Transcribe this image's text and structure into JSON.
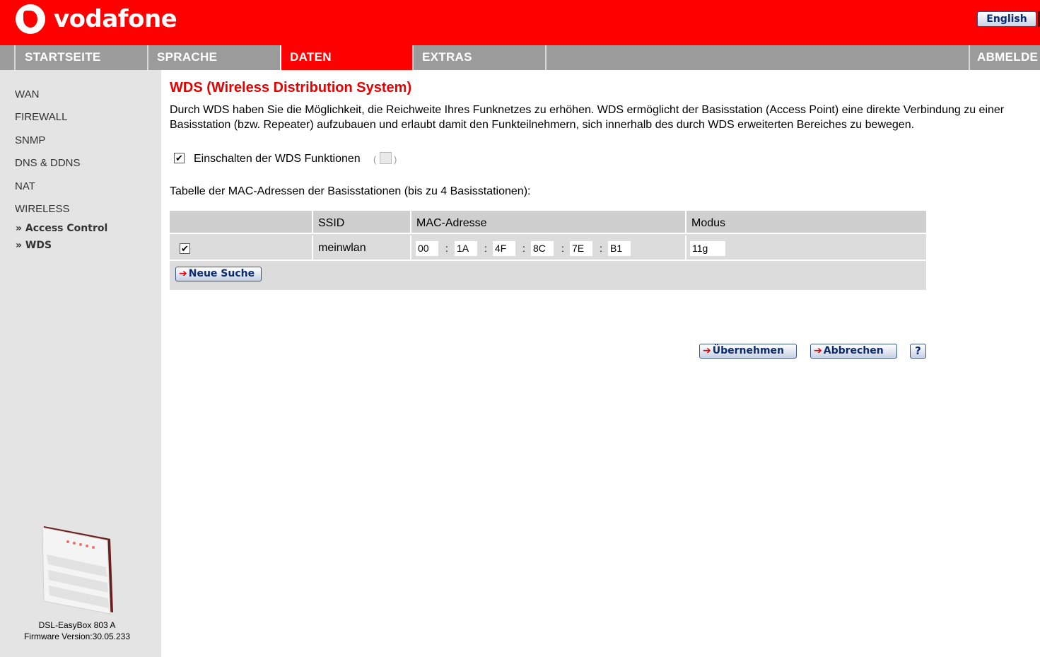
{
  "header": {
    "brand": "vodafone",
    "language_button": "English"
  },
  "nav": {
    "items": [
      {
        "label": "STARTSEITE"
      },
      {
        "label": "SPRACHE"
      },
      {
        "label": "DATEN",
        "active": true
      },
      {
        "label": "EXTRAS"
      },
      {
        "label": "ABMELDE"
      }
    ]
  },
  "sidebar": {
    "links": [
      "WAN",
      "FIREWALL",
      "SNMP",
      "DNS & DDNS",
      "NAT",
      "WIRELESS"
    ],
    "sub_links": [
      "» Access Control",
      "» WDS"
    ],
    "device_name": "DSL-EasyBox 803 A",
    "firmware": "Firmware Version:30.05.233"
  },
  "main": {
    "title": "WDS (Wireless Distribution System)",
    "description_line1": "Durch WDS haben Sie die Möglichkeit, die Reichweite Ihres Funknetzes zu erhöhen. WDS ermöglicht der Basisstation (Access Point) eine direkte Verbindung zu einer",
    "description_line2": "Basisstation (bzw. Repeater) aufzubauen und erlaubt damit den Funkteilnehmern, sich innerhalb des durch WDS erweiterten Bereiches zu bewegen.",
    "enable_label": "Einschalten der WDS Funktionen",
    "enable_checked": true,
    "table_caption": "Tabelle der MAC-Adressen der Basisstationen (bis zu 4 Basisstationen):",
    "table": {
      "headers": [
        "",
        "SSID",
        "MAC-Adresse",
        "Modus"
      ],
      "rows": [
        {
          "checked": true,
          "ssid": "meinwlan",
          "mac": [
            "00",
            "1A",
            "4F",
            "8C",
            "7E",
            "B1"
          ],
          "modus": "11g"
        }
      ],
      "search_button": "Neue Suche"
    },
    "apply_button": "Übernehmen",
    "cancel_button": "Abbrechen",
    "help_button": "?"
  },
  "colors": {
    "brand_red": "#ff0000",
    "nav_gray": "#9b9b9b",
    "sidebar_bg": "#e4e4e4",
    "title_red": "#e60000",
    "button_text": "#0b2a6e"
  }
}
